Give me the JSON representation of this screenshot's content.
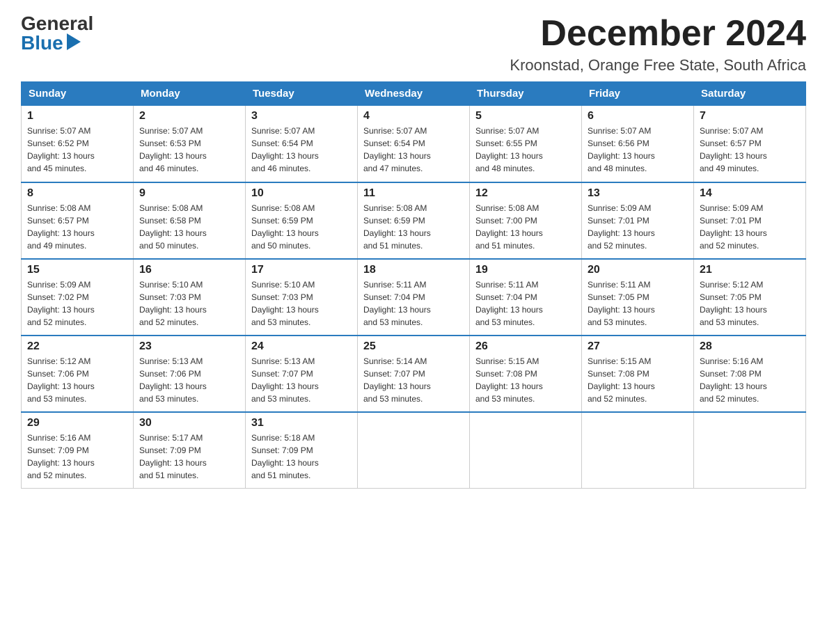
{
  "logo": {
    "general": "General",
    "blue": "Blue"
  },
  "title": {
    "month": "December 2024",
    "location": "Kroonstad, Orange Free State, South Africa"
  },
  "headers": [
    "Sunday",
    "Monday",
    "Tuesday",
    "Wednesday",
    "Thursday",
    "Friday",
    "Saturday"
  ],
  "weeks": [
    [
      {
        "day": "1",
        "sunrise": "5:07 AM",
        "sunset": "6:52 PM",
        "daylight": "13 hours and 45 minutes."
      },
      {
        "day": "2",
        "sunrise": "5:07 AM",
        "sunset": "6:53 PM",
        "daylight": "13 hours and 46 minutes."
      },
      {
        "day": "3",
        "sunrise": "5:07 AM",
        "sunset": "6:54 PM",
        "daylight": "13 hours and 46 minutes."
      },
      {
        "day": "4",
        "sunrise": "5:07 AM",
        "sunset": "6:54 PM",
        "daylight": "13 hours and 47 minutes."
      },
      {
        "day": "5",
        "sunrise": "5:07 AM",
        "sunset": "6:55 PM",
        "daylight": "13 hours and 48 minutes."
      },
      {
        "day": "6",
        "sunrise": "5:07 AM",
        "sunset": "6:56 PM",
        "daylight": "13 hours and 48 minutes."
      },
      {
        "day": "7",
        "sunrise": "5:07 AM",
        "sunset": "6:57 PM",
        "daylight": "13 hours and 49 minutes."
      }
    ],
    [
      {
        "day": "8",
        "sunrise": "5:08 AM",
        "sunset": "6:57 PM",
        "daylight": "13 hours and 49 minutes."
      },
      {
        "day": "9",
        "sunrise": "5:08 AM",
        "sunset": "6:58 PM",
        "daylight": "13 hours and 50 minutes."
      },
      {
        "day": "10",
        "sunrise": "5:08 AM",
        "sunset": "6:59 PM",
        "daylight": "13 hours and 50 minutes."
      },
      {
        "day": "11",
        "sunrise": "5:08 AM",
        "sunset": "6:59 PM",
        "daylight": "13 hours and 51 minutes."
      },
      {
        "day": "12",
        "sunrise": "5:08 AM",
        "sunset": "7:00 PM",
        "daylight": "13 hours and 51 minutes."
      },
      {
        "day": "13",
        "sunrise": "5:09 AM",
        "sunset": "7:01 PM",
        "daylight": "13 hours and 52 minutes."
      },
      {
        "day": "14",
        "sunrise": "5:09 AM",
        "sunset": "7:01 PM",
        "daylight": "13 hours and 52 minutes."
      }
    ],
    [
      {
        "day": "15",
        "sunrise": "5:09 AM",
        "sunset": "7:02 PM",
        "daylight": "13 hours and 52 minutes."
      },
      {
        "day": "16",
        "sunrise": "5:10 AM",
        "sunset": "7:03 PM",
        "daylight": "13 hours and 52 minutes."
      },
      {
        "day": "17",
        "sunrise": "5:10 AM",
        "sunset": "7:03 PM",
        "daylight": "13 hours and 53 minutes."
      },
      {
        "day": "18",
        "sunrise": "5:11 AM",
        "sunset": "7:04 PM",
        "daylight": "13 hours and 53 minutes."
      },
      {
        "day": "19",
        "sunrise": "5:11 AM",
        "sunset": "7:04 PM",
        "daylight": "13 hours and 53 minutes."
      },
      {
        "day": "20",
        "sunrise": "5:11 AM",
        "sunset": "7:05 PM",
        "daylight": "13 hours and 53 minutes."
      },
      {
        "day": "21",
        "sunrise": "5:12 AM",
        "sunset": "7:05 PM",
        "daylight": "13 hours and 53 minutes."
      }
    ],
    [
      {
        "day": "22",
        "sunrise": "5:12 AM",
        "sunset": "7:06 PM",
        "daylight": "13 hours and 53 minutes."
      },
      {
        "day": "23",
        "sunrise": "5:13 AM",
        "sunset": "7:06 PM",
        "daylight": "13 hours and 53 minutes."
      },
      {
        "day": "24",
        "sunrise": "5:13 AM",
        "sunset": "7:07 PM",
        "daylight": "13 hours and 53 minutes."
      },
      {
        "day": "25",
        "sunrise": "5:14 AM",
        "sunset": "7:07 PM",
        "daylight": "13 hours and 53 minutes."
      },
      {
        "day": "26",
        "sunrise": "5:15 AM",
        "sunset": "7:08 PM",
        "daylight": "13 hours and 53 minutes."
      },
      {
        "day": "27",
        "sunrise": "5:15 AM",
        "sunset": "7:08 PM",
        "daylight": "13 hours and 52 minutes."
      },
      {
        "day": "28",
        "sunrise": "5:16 AM",
        "sunset": "7:08 PM",
        "daylight": "13 hours and 52 minutes."
      }
    ],
    [
      {
        "day": "29",
        "sunrise": "5:16 AM",
        "sunset": "7:09 PM",
        "daylight": "13 hours and 52 minutes."
      },
      {
        "day": "30",
        "sunrise": "5:17 AM",
        "sunset": "7:09 PM",
        "daylight": "13 hours and 51 minutes."
      },
      {
        "day": "31",
        "sunrise": "5:18 AM",
        "sunset": "7:09 PM",
        "daylight": "13 hours and 51 minutes."
      },
      null,
      null,
      null,
      null
    ]
  ],
  "labels": {
    "sunrise": "Sunrise:",
    "sunset": "Sunset:",
    "daylight": "Daylight:"
  }
}
